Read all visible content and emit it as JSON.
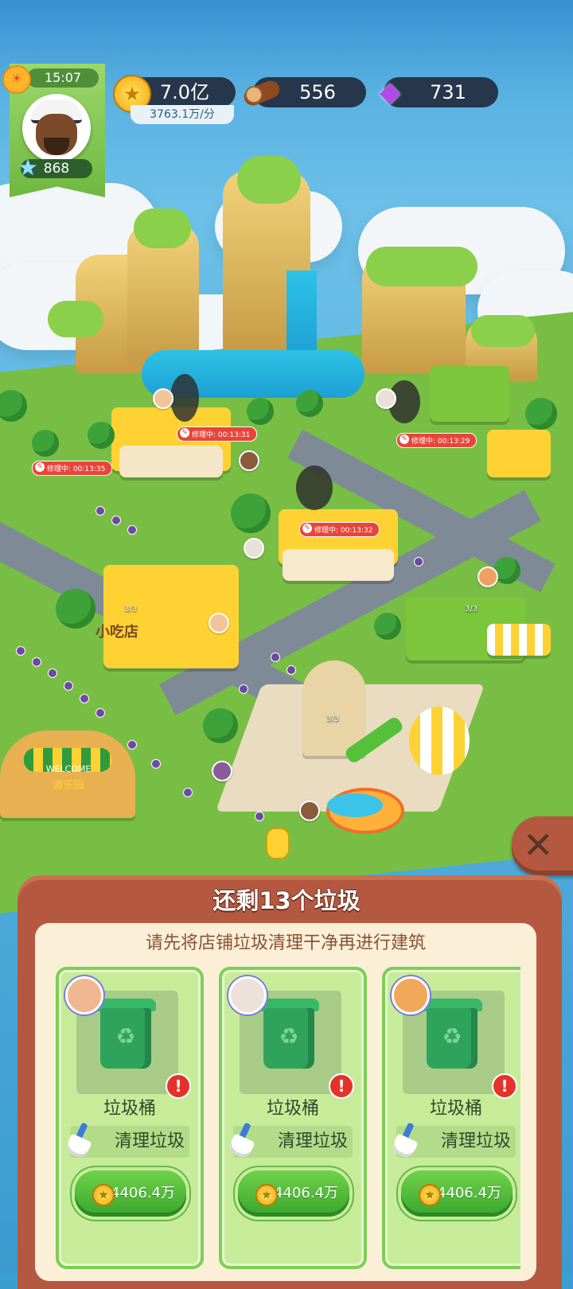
{
  "hud": {
    "time": "15:07",
    "player_level": "868",
    "coins": "7.0亿",
    "coin_rate": "3763.1万/分",
    "wood": "556",
    "gems": "731"
  },
  "scene": {
    "repair_labels": [
      "修理中: 00:13:35",
      "修理中: 00:13:31",
      "修理中: 00:13:32",
      "修理中: 00:13:29"
    ],
    "capacity_counts": [
      "3/3",
      "3/3",
      "3/3"
    ],
    "shop_sign": "小吃店",
    "gate_sign_top": "WELCOME",
    "gate_sign_bottom": "游乐园"
  },
  "panel": {
    "title": "还剩13个垃圾",
    "subtitle": "请先将店铺垃圾清理干净再进行建筑",
    "cards": [
      {
        "name": "垃圾桶",
        "action": "清理垃圾",
        "cost": "4406.4万"
      },
      {
        "name": "垃圾桶",
        "action": "清理垃圾",
        "cost": "4406.4万"
      },
      {
        "name": "垃圾桶",
        "action": "清理垃圾",
        "cost": "4406.4万"
      }
    ]
  },
  "icons": {
    "sun": "sun-icon",
    "star": "star-icon",
    "coin": "coin-icon",
    "wood": "wood-log-icon",
    "gem": "gem-icon",
    "close": "close-icon",
    "trash": "trash-bin-icon",
    "broom": "broom-icon",
    "alert": "alert-icon"
  },
  "colors": {
    "panel_brown": "#b4593f",
    "panel_cream": "#fbefd8",
    "card_green": "#c6ec9a",
    "button_green": "#3aa62d",
    "alert_red": "#e53228",
    "hud_dark": "#26364c"
  }
}
